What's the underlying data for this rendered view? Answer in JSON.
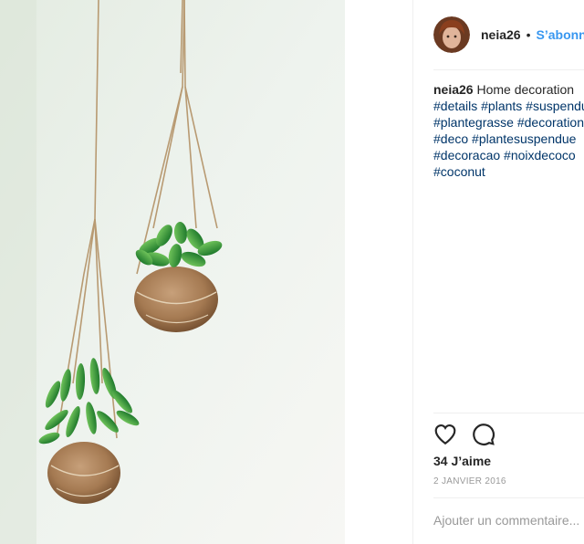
{
  "post": {
    "username": "neia26",
    "follow_label": "S’abonner",
    "caption": {
      "username": "neia26",
      "text": "Home decoration",
      "hashtag_lines": [
        "#details #plants #suspendu",
        "#plantegrasse #decoration",
        "#deco #plantesuspendue",
        "#decoracao #noixdecoco",
        "#coconut"
      ]
    },
    "likes": "34 J’aime",
    "date": "2 JANVIER 2016",
    "comment_placeholder": "Ajouter un commentaire..."
  },
  "icons": {
    "like": "heart-icon",
    "comment": "comment-icon"
  },
  "colors": {
    "follow": "#3897f0",
    "hashtag": "#003569",
    "meta": "#999999"
  }
}
